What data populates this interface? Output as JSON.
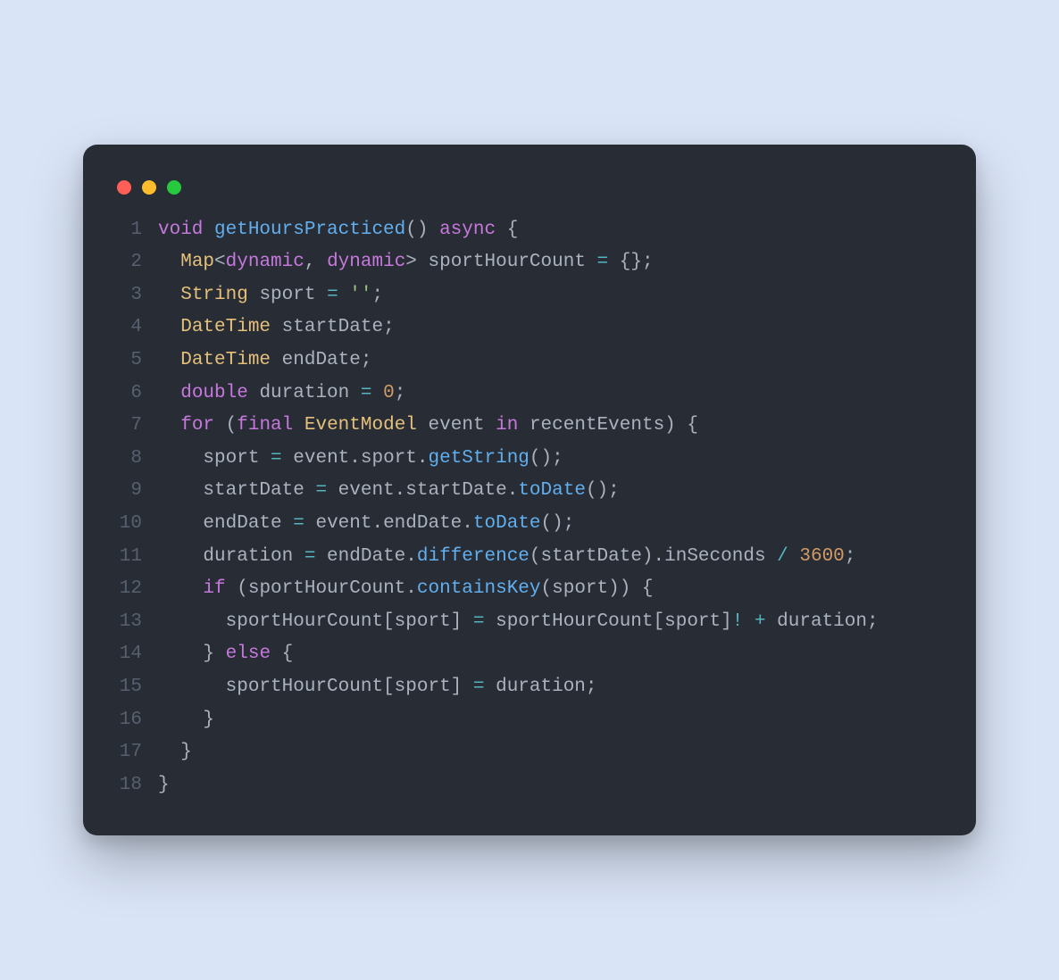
{
  "window": {
    "dots": [
      "red",
      "yellow",
      "green"
    ]
  },
  "colors": {
    "bg_page": "#d9e4f6",
    "bg_card": "#282c34",
    "gutter": "#56606f",
    "text": "#abb2bf",
    "keyword": "#c678dd",
    "type": "#e5c07b",
    "function": "#61afef",
    "string": "#98c379",
    "number": "#d19a66",
    "operator": "#56b6c2",
    "identifier": "#e06c75"
  },
  "code": {
    "language": "dart",
    "line_numbers": [
      "1",
      "2",
      "3",
      "4",
      "5",
      "6",
      "7",
      "8",
      "9",
      "10",
      "11",
      "12",
      "13",
      "14",
      "15",
      "16",
      "17",
      "18"
    ],
    "lines": [
      [
        {
          "t": "void ",
          "c": "kw"
        },
        {
          "t": "getHoursPracticed",
          "c": "fn"
        },
        {
          "t": "() ",
          "c": "plain"
        },
        {
          "t": "async",
          "c": "kw"
        },
        {
          "t": " {",
          "c": "plain"
        }
      ],
      [
        {
          "t": "  ",
          "c": "plain"
        },
        {
          "t": "Map",
          "c": "type"
        },
        {
          "t": "<",
          "c": "plain"
        },
        {
          "t": "dynamic",
          "c": "kw"
        },
        {
          "t": ", ",
          "c": "plain"
        },
        {
          "t": "dynamic",
          "c": "kw"
        },
        {
          "t": "> sportHourCount ",
          "c": "plain"
        },
        {
          "t": "=",
          "c": "op"
        },
        {
          "t": " {};",
          "c": "plain"
        }
      ],
      [
        {
          "t": "  ",
          "c": "plain"
        },
        {
          "t": "String",
          "c": "type"
        },
        {
          "t": " sport ",
          "c": "plain"
        },
        {
          "t": "=",
          "c": "op"
        },
        {
          "t": " ",
          "c": "plain"
        },
        {
          "t": "''",
          "c": "str"
        },
        {
          "t": ";",
          "c": "plain"
        }
      ],
      [
        {
          "t": "  ",
          "c": "plain"
        },
        {
          "t": "DateTime",
          "c": "type"
        },
        {
          "t": " startDate;",
          "c": "plain"
        }
      ],
      [
        {
          "t": "  ",
          "c": "plain"
        },
        {
          "t": "DateTime",
          "c": "type"
        },
        {
          "t": " endDate;",
          "c": "plain"
        }
      ],
      [
        {
          "t": "  ",
          "c": "plain"
        },
        {
          "t": "double",
          "c": "kw"
        },
        {
          "t": " duration ",
          "c": "plain"
        },
        {
          "t": "=",
          "c": "op"
        },
        {
          "t": " ",
          "c": "plain"
        },
        {
          "t": "0",
          "c": "num"
        },
        {
          "t": ";",
          "c": "plain"
        }
      ],
      [
        {
          "t": "  ",
          "c": "plain"
        },
        {
          "t": "for",
          "c": "kw"
        },
        {
          "t": " (",
          "c": "plain"
        },
        {
          "t": "final",
          "c": "kw"
        },
        {
          "t": " ",
          "c": "plain"
        },
        {
          "t": "EventModel",
          "c": "type"
        },
        {
          "t": " event ",
          "c": "plain"
        },
        {
          "t": "in",
          "c": "kw"
        },
        {
          "t": " recentEvents) {",
          "c": "plain"
        }
      ],
      [
        {
          "t": "    sport ",
          "c": "plain"
        },
        {
          "t": "=",
          "c": "op"
        },
        {
          "t": " event.sport.",
          "c": "plain"
        },
        {
          "t": "getString",
          "c": "fn"
        },
        {
          "t": "();",
          "c": "plain"
        }
      ],
      [
        {
          "t": "    startDate ",
          "c": "plain"
        },
        {
          "t": "=",
          "c": "op"
        },
        {
          "t": " event.startDate.",
          "c": "plain"
        },
        {
          "t": "toDate",
          "c": "fn"
        },
        {
          "t": "();",
          "c": "plain"
        }
      ],
      [
        {
          "t": "    endDate ",
          "c": "plain"
        },
        {
          "t": "=",
          "c": "op"
        },
        {
          "t": " event.endDate.",
          "c": "plain"
        },
        {
          "t": "toDate",
          "c": "fn"
        },
        {
          "t": "();",
          "c": "plain"
        }
      ],
      [
        {
          "t": "    duration ",
          "c": "plain"
        },
        {
          "t": "=",
          "c": "op"
        },
        {
          "t": " endDate.",
          "c": "plain"
        },
        {
          "t": "difference",
          "c": "fn"
        },
        {
          "t": "(startDate).inSeconds ",
          "c": "plain"
        },
        {
          "t": "/",
          "c": "op"
        },
        {
          "t": " ",
          "c": "plain"
        },
        {
          "t": "3600",
          "c": "num"
        },
        {
          "t": ";",
          "c": "plain"
        }
      ],
      [
        {
          "t": "    ",
          "c": "plain"
        },
        {
          "t": "if",
          "c": "kw"
        },
        {
          "t": " (sportHourCount.",
          "c": "plain"
        },
        {
          "t": "containsKey",
          "c": "fn"
        },
        {
          "t": "(sport)) {",
          "c": "plain"
        }
      ],
      [
        {
          "t": "      sportHourCount[sport] ",
          "c": "plain"
        },
        {
          "t": "=",
          "c": "op"
        },
        {
          "t": " sportHourCount[sport]",
          "c": "plain"
        },
        {
          "t": "!",
          "c": "op"
        },
        {
          "t": " ",
          "c": "plain"
        },
        {
          "t": "+",
          "c": "op"
        },
        {
          "t": " duration;",
          "c": "plain"
        }
      ],
      [
        {
          "t": "    } ",
          "c": "plain"
        },
        {
          "t": "else",
          "c": "kw"
        },
        {
          "t": " {",
          "c": "plain"
        }
      ],
      [
        {
          "t": "      sportHourCount[sport] ",
          "c": "plain"
        },
        {
          "t": "=",
          "c": "op"
        },
        {
          "t": " duration;",
          "c": "plain"
        }
      ],
      [
        {
          "t": "    }",
          "c": "plain"
        }
      ],
      [
        {
          "t": "  }",
          "c": "plain"
        }
      ],
      [
        {
          "t": "}",
          "c": "plain"
        }
      ]
    ]
  }
}
